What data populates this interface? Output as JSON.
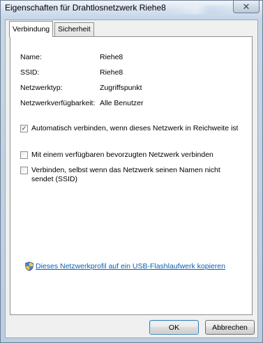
{
  "window": {
    "title": "Eigenschaften für Drahtlosnetzwerk Riehe8",
    "close_glyph": "✕"
  },
  "tabs": [
    {
      "label": "Verbindung",
      "active": true
    },
    {
      "label": "Sicherheit",
      "active": false
    }
  ],
  "properties": [
    {
      "label": "Name:",
      "value": "Riehe8"
    },
    {
      "label": "SSID:",
      "value": "Riehe8"
    },
    {
      "label": "Netzwerktyp:",
      "value": "Zugriffspunkt"
    },
    {
      "label": "Netzwerkverfügbarkeit:",
      "value": "Alle Benutzer"
    }
  ],
  "options": [
    {
      "label": "Automatisch verbinden, wenn dieses Netzwerk in Reichweite ist",
      "checked": true
    },
    {
      "label": "Mit einem verfügbaren bevorzugten Netzwerk verbinden",
      "checked": false
    },
    {
      "label": "Verbinden, selbst wenn das Netzwerk seinen Namen nicht sendet (SSID)",
      "checked": false
    }
  ],
  "copy_link": {
    "icon": "uac-shield-icon",
    "label": "Dieses Netzwerkprofil auf ein USB-Flashlaufwerk kopieren"
  },
  "buttons": {
    "ok": "OK",
    "cancel": "Abbrechen"
  },
  "colors": {
    "link": "#0b5fb3",
    "check_mark": "#1c3f7a",
    "default_button_border": "#3c7fb1"
  }
}
